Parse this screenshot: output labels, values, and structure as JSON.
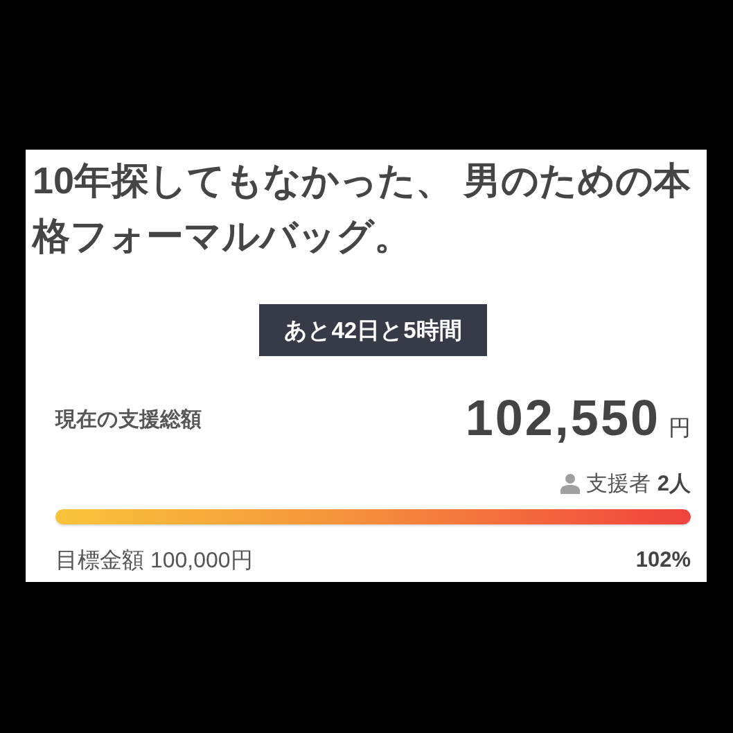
{
  "title": "10年探してもなかった、 男のための本格フォーマルバッグ。",
  "remaining": "あと42日と5時間",
  "total": {
    "label": "現在の支援総額",
    "amount": "102,550",
    "unit": "円"
  },
  "supporters": {
    "label": "支援者",
    "count": "2人"
  },
  "progress": {
    "level": 1
  },
  "goal": {
    "label": "目標金額 100,000円",
    "percent": "102%"
  }
}
